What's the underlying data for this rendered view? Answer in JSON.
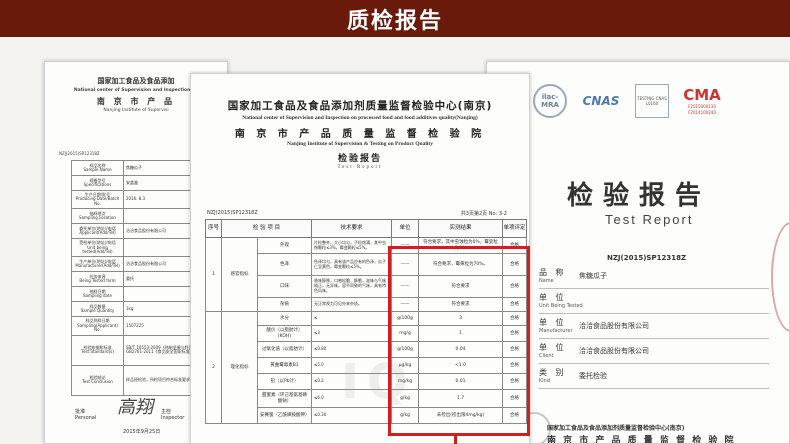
{
  "banner": {
    "title": "质检报告"
  },
  "left_report": {
    "header_cn": "国家加工食品及食品添加",
    "header_en": "National center of Supervision and Inspection on",
    "header_cn2": "南 京 市 产 品",
    "header_en2": "Nanjing Institute of Supervisi",
    "report_no": "NZJ(2015)SP12318Z",
    "rows": [
      {
        "label_cn": "样品名称",
        "label_en": "Sample Name",
        "value": "焦糖瓜子"
      },
      {
        "label_cn": "规格型号",
        "label_en": "Specifications",
        "value": "安盖盒"
      },
      {
        "label_cn": "生产日期/批号",
        "label_en": "Producing Date/Batch No.",
        "value": "2016. 8.3"
      },
      {
        "label_cn": "抽样地点",
        "label_en": "Sampling Location",
        "value": ""
      },
      {
        "label_cn": "委托单位(地址)/电话",
        "label_en": "Applicant(Add/Tel)",
        "value": "洽洽食品股份有限公司"
      },
      {
        "label_cn": "受检单位(地址)/电话",
        "label_en": "Unit being tested(Add/Tel)",
        "value": ""
      },
      {
        "label_cn": "生产单位(地址)/电话",
        "label_en": "Manufacturer(Add/Tel)",
        "value": "洽洽食品股份有限公司"
      },
      {
        "label_cn": "任务来源",
        "label_en": "Being Tested form",
        "value": "委托"
      },
      {
        "label_cn": "抽样日期",
        "label_en": "Sampling date",
        "value": ""
      },
      {
        "label_cn": "样品数量",
        "label_en": "Sample Quantity",
        "value": "1kg"
      },
      {
        "label_cn": "样品到样日期",
        "label_en": "Sampling(Applicant) No.",
        "value": "1507225"
      },
      {
        "label_cn": "检验依据和标准",
        "label_en": "Test Standard(s)",
        "value": "SB/T 10553-2009《熟制坚果与籽类食品》、GB2761-2011《食品安全国家标准》"
      },
      {
        "label_cn": "检验结论",
        "label_en": "Test Conclusion",
        "value": "样品经检验，所检项目符合标准要求"
      }
    ],
    "signature_label_cn": "批准",
    "signature_label_en": "Personal",
    "signature_name": "高翔",
    "inspector_label_cn": "主检",
    "inspector_label_en": "Inspector",
    "date": "2015年9月25日"
  },
  "right_report": {
    "logos": [
      "ilac-MRA",
      "CNAS",
      "TESTING CNAS L0160",
      "CMA"
    ],
    "cma_no1": "F2015000133",
    "cma_no2": "F2014100240",
    "title": "检验报告",
    "subtitle": "Test Report",
    "report_no": "NZJ(2015)SP12318Z",
    "rows": [
      {
        "label": "品 称",
        "label_en": "Name",
        "value": "焦糖瓜子"
      },
      {
        "label": "单 位",
        "label_en": "Unit Being Tested",
        "value": ""
      },
      {
        "label": "单 位",
        "label_en": "Manufacturer",
        "value": "洽洽食品股份有限公司"
      },
      {
        "label": "单 位",
        "label_en": "Client",
        "value": "洽洽食品股份有限公司"
      },
      {
        "label": "类 别",
        "label_en": "Kind",
        "value": "委托检验"
      }
    ],
    "footer_cn": "国家加工食品及食品添加剂质量监督检验中心(南京)",
    "footer_cn2": "南 京 市 产 品 质 量 监 督 检 验 院"
  },
  "center_report": {
    "header_cn": "国家加工食品及食品添加剂质量监督检验中心(南京)",
    "header_en": "National center of Supervision and Inspection on processed food and food additives quality(Nanjing)",
    "header_cn2": "南 京 市 产 品 质 量 监 督 检 验 院",
    "header_en2": "Nanjing Institute of Supervision & Testing on Product Quality",
    "title": "检验报告",
    "subtitle": "Test Report",
    "report_no": "NZJ(2015)SP12318Z",
    "page": "共3页第2页 No: 3-2",
    "columns": [
      "序号",
      "检 验 项 目",
      "技术要求",
      "单位",
      "实测结果",
      "单项评定"
    ],
    "group1": {
      "no": "1",
      "name": "感官指标"
    },
    "group2": {
      "no": "2",
      "name": "理化指标"
    },
    "rows": [
      {
        "item": "外观",
        "req": "片粒整齐，大小均匀，子粒饱满，其中虫蚀颗粒≤3%，霉变颗粒≤5%。",
        "unit": "——",
        "result": "符合要求，其中虫蚀粒为0%，霉变粒为0%",
        "eval": "合格"
      },
      {
        "item": "色泽",
        "req": "色泽均匀，具有该产品应有的色泽，瓜子仁呈黄色，霉变颗粒≤5%。",
        "unit": "——",
        "result": "符合要求，霉黄粒为70%。",
        "eval": "合格"
      },
      {
        "item": "口味",
        "req": "香味醇厚，口感松脆、酥脆，滋味与气味纯正，无异味，容不同致的气味，具有特色风味。",
        "unit": "——",
        "result": "符合要求",
        "eval": "合格"
      },
      {
        "item": "杂质",
        "req": "无正常视力可见外来杂质。",
        "unit": "——",
        "result": "符合要求",
        "eval": "合格"
      },
      {
        "item": "水分",
        "req": "≤",
        "unit": "g/100g",
        "result": "3",
        "eval": "合格"
      },
      {
        "item": "酸价（以脂肪计）(KOH)",
        "req": "≤3",
        "unit": "mg/g",
        "result": "1",
        "eval": "合格"
      },
      {
        "item": "过氧化值（以脂肪计）",
        "req": "≤0.80",
        "unit": "g/100g",
        "result": "0.04",
        "eval": "合格"
      },
      {
        "item": "黄曲霉毒素B1",
        "req": "≤5.0",
        "unit": "μg/kg",
        "result": "<1.0",
        "eval": "合格"
      },
      {
        "item": "铅（以Pb计）",
        "req": "≤0.2",
        "unit": "mg/kg",
        "result": "0.01",
        "eval": "合格"
      },
      {
        "item": "甜蜜素（环己基氨基磺酸钠）",
        "req": "≤6.0",
        "unit": "g/kg",
        "result": "1.7",
        "eval": "合格"
      },
      {
        "item": "安赛蜜（乙酰磺胺酸钾）",
        "req": "≤0.30",
        "unit": "g/kg",
        "result": "未检出(检出限4mg/kg)",
        "eval": "合格"
      }
    ],
    "watermark": "IQ"
  },
  "colors": {
    "banner": "#6a1a0a",
    "highlight": "#d41d1d"
  }
}
